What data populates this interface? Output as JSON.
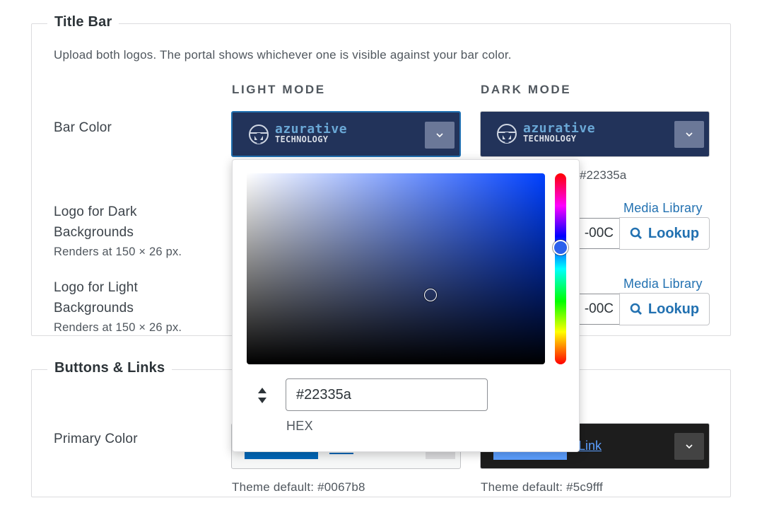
{
  "title_bar": {
    "legend": "Title Bar",
    "description": "Upload both logos. The portal shows whichever one is visible against your bar color.",
    "col_light": "LIGHT MODE",
    "col_dark": "DARK MODE",
    "bar_color_label": "Bar Color",
    "logo_text_line1": "azurative",
    "logo_text_line2": "TECHNOLOGY",
    "dark_hex_caption": "#22335a",
    "logo_dark_label": "Logo for Dark Backgrounds",
    "logo_dark_hint": "Renders at 150 × 26 px.",
    "logo_light_label": "Logo for Light Backgrounds",
    "logo_light_hint": "Renders at 150 × 26 px.",
    "media_library_1": "Media Library",
    "media_library_2": "Media Library",
    "input_frag_1": "-00C",
    "input_frag_2": "-00C",
    "lookup_1": "Lookup",
    "lookup_2": "Lookup",
    "bar_color": "#22335a"
  },
  "buttons_links": {
    "legend": "Buttons & Links",
    "primary_color_label": "Primary Color",
    "dark_link_text": "Link",
    "light_default": "Theme default: #0067b8",
    "dark_default": "Theme default: #5c9fff"
  },
  "color_picker": {
    "hex_value": "#22335a",
    "hex_label": "HEX"
  }
}
